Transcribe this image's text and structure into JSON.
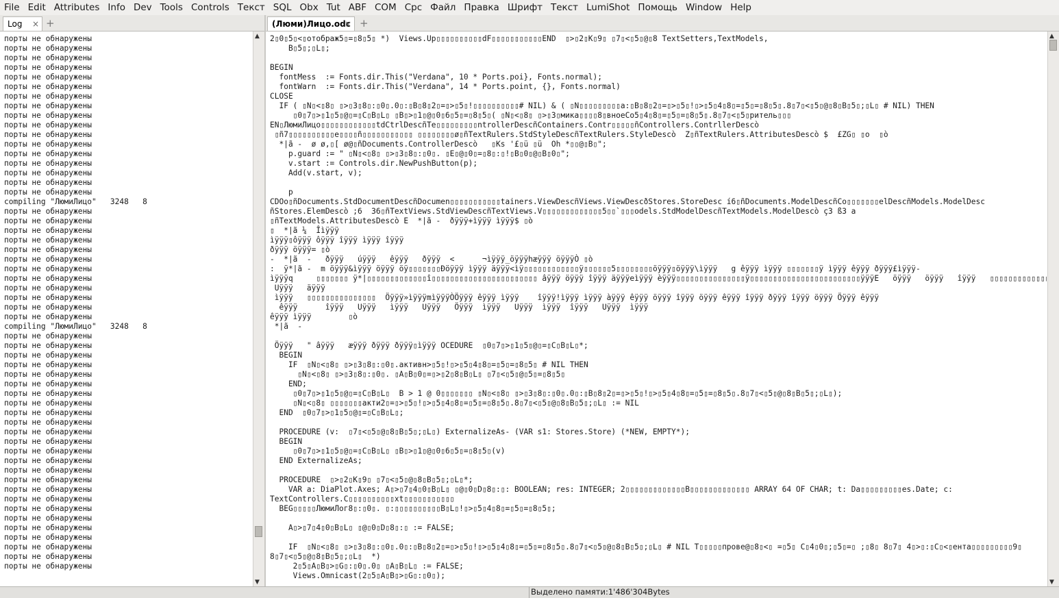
{
  "menubar": [
    "File",
    "Edit",
    "Attributes",
    "Info",
    "Dev",
    "Tools",
    "Controls",
    "Текст",
    "SQL",
    "Obx",
    "Tut",
    "ABF",
    "COM",
    "Срс",
    "Файл",
    "Правка",
    "Шрифт",
    "Текст",
    "LumiShot",
    "Помощь",
    "Window",
    "Help"
  ],
  "left_tab": {
    "label": "Log",
    "close": "×",
    "plus": "+"
  },
  "right_tab": {
    "label": "(Люми)Лицо.odc",
    "close": "×",
    "plus": "+"
  },
  "log": {
    "lines": [
      "порты не обнаружены",
      "порты не обнаружены",
      "порты не обнаружены",
      "порты не обнаружены",
      "порты не обнаружены",
      "порты не обнаружены",
      "порты не обнаружены",
      "порты не обнаружены",
      "порты не обнаружены",
      "порты не обнаружены",
      "порты не обнаружены",
      "порты не обнаружены",
      "порты не обнаружены",
      "порты не обнаружены",
      "порты не обнаружены",
      "порты не обнаружены",
      "порты не обнаружены",
      "compiling \"ЛюмиЛицо\"   3248   8",
      "порты не обнаружены",
      "порты не обнаружены",
      "порты не обнаружены",
      "порты не обнаружены",
      "порты не обнаружены",
      "порты не обнаружены",
      "порты не обнаружены",
      "порты не обнаружены",
      "порты не обнаружены",
      "порты не обнаружены",
      "порты не обнаружены",
      "порты не обнаружены",
      "compiling \"ЛюмиЛицо\"   3248   8",
      "порты не обнаружены",
      "порты не обнаружены",
      "порты не обнаружены",
      "порты не обнаружены",
      "порты не обнаружены",
      "порты не обнаружены",
      "порты не обнаружены",
      "порты не обнаружены",
      "порты не обнаружены",
      "порты не обнаружены",
      "порты не обнаружены",
      "порты не обнаружены",
      "порты не обнаружены",
      "порты не обнаружены",
      "порты не обнаружены",
      "порты не обнаружены",
      "порты не обнаружены",
      "порты не обнаружены",
      "порты не обнаружены",
      "порты не обнаружены",
      "порты не обнаружены",
      "порты не обнаружены",
      "порты не обнаружены",
      "порты не обнаружены",
      "порты не обнаружены"
    ]
  },
  "editor": {
    "lines": [
      "2▯0▯5▯<▯отображ5▯=▯8▯5▯ *)  Views.Up▯▯▯▯▯▯▯▯▯▯dF▯▯▯▯▯▯▯▯▯▯▯END  ▯>▯2▯K▯9▯ ▯7▯<▯5▯@▯8 TextSetters,TextModels,",
      "    B▯5▯;▯L▯;",
      "",
      "BEGIN",
      "  fontMess  := Fonts.dir.This(\"Verdana\", 10 * Ports.poi}, Fonts.normal);",
      "  fontWarn  := Fonts.dir.This(\"Verdana\", 14 * Ports.point, {}, Fonts.normal)",
      "CLOSE",
      "  IF ( ▯N▯<▯8▯ ▯>▯3▯8▯:▯0▯.0▯:▯B▯8▯2▯=▯>▯5▯!▯▯▯▯▯▯▯▯▯▯# NIL) & ( ▯N▯▯▯▯▯▯▯▯▯a:▯B▯8▯2▯=▯>▯5▯!▯>▯5▯4▯8▯=▯5▯=▯8▯5▯.8▯7▯<▯5▯@▯8▯B▯5▯;▯L▯ # NIL) THEN",
      "     ▯0▯7▯>▯1▯5▯@▯=▯C▯B▯L▯ ▯B▯>▯1▯@▯0▯6▯5▯=▯8▯5▯( ▯N▯<▯8▯ ▯>▯3▯мика▯▯▯▯8▯вноеСо5▯4▯8▯=▯5▯=▯8▯5▯.8▯7▯<▯5▯ритель▯▯▯",
      "EN▯ЛюмиЛицо▯▯▯▯▯▯▯▯▯▯▯▯tdCtrlDescñTe▯▯▯▯▯▯▯▯▯ntrollerDescñContainers.Contr▯▯▯▯▯ñControllers.ContrllerDescò",
      " ▯ñ7▯▯▯▯▯▯▯▯▯▯e▯▯▯▯ñ▯▯▯▯▯▯▯▯▯▯▯ ▯▯▯▯▯▯▯▯ø▯ñTextRulers.StdStyleDescñTextRulers.StyleDescò  Z▯ñTextRulers.AttributesDescò $  £ZG▯ ▯o  ▯ò",
      "  *|ã -  ø ø,▯[ ø@▯ñDocuments.ControllerDescò   ▯Ks '£▯ü ▯ü  Oh *▯▯@▯B▯\";",
      "    p.guard := \" ▯N▯<▯8▯ ▯>▯3▯8▯:▯0▯. ▯E▯@▯0▯=▯8▯:▯!▯B▯0▯@▯B▯0▯\";",
      "    v.start := Controls.dir.NewPushButton(p);",
      "    Add(v.start, v);",
      "",
      "    p",
      "CDOo▯ñDocuments.StdDocumentDescñDocumen▯▯▯▯▯▯▯▯▯▯▯tainers.ViewDescñViews.ViewDescðStores.StoreDesc í6▯ñDocuments.ModelDescñCo▯▯▯▯▯▯▯elDescñModels.ModelDesc",
      "ñStores.ElemDescò ;6  36▯ñTextViews.StdViewDescñTextViews.V▯▯▯▯▯▯▯▯▯▯▯▯▯5▯▯`▯▯▯odels.StdModelDescñTextModels.ModelDescò ç3 ß3 a",
      "▯ñTextModels.AttributesDescò E  *|ã -  ðÿÿÿ+ìÿÿÿ ìÿÿÿ$ ▯ò",
      "▯  *|ã ¼  Îìÿÿÿ",
      "ìÿÿÿ▯ôÿÿÿ ôÿÿÿ îÿÿÿ ìÿÿÿ îÿÿÿ",
      "ðÿÿÿ öÿÿÿ= ▯ò",
      "-  *|ã  -   ðÿÿÿ   úÿÿÿ   êÿÿÿ   ðÿÿÿ  <      ¬ìÿÿÿ_öÿÿÿhæÿÿÿ öÿÿÿÒ ▯ò",
      ":  ÿ*|ã -  m öÿÿÿ&ìÿÿÿ öÿÿÿ öÿ▯▯▯▯▯▯▯Ðöÿÿÿ ìÿÿÿ äÿÿÿ<ìÿ▯▯▯▯▯▯▯▯▯▯▯▯ÿ▯▯▯▯▯▯5▯▯▯▯▯▯▯▯öÿÿÿ▯öÿÿÿ\\ìÿÿÿ   g êÿÿÿ ìÿÿÿ ▯▯▯▯▯▯▯ÿ ìÿÿÿ êÿÿÿ ðÿÿÿ£ìÿÿÿ-",
      "ìÿÿÿq     ▯▯▯▯▯▯▯ ÿ*|▯▯▯▯▯▯▯▯▯▯▯▯▯î▯▯▯▯▯▯▯▯▯▯▯▯▯▯▯▯▯▯▯▯▯▯▯ âÿÿÿ öÿÿÿ îÿÿÿ äÿÿÿeìÿÿÿ èÿÿÿ▯▯▯▯▯▯▯▯▯▯▯▯▯▯▯ÿ▯▯▯▯▯▯▯▯▯▯▯▯▯▯▯▯▯▯▯▯▯▯▯▯ÿÿÿE   öÿÿÿ   öÿÿÿ   îÿÿÿ   ▯▯▯▯▯▯▯▯▯▯▯▯▯▯▯▯▯▯▯▯▯▯▯▯▯▯▯▯▯▯▯▯▯▯▯▯▯▯▯▯▯ÿ    ìÿÿÿ",
      " Uÿÿÿ   äÿÿÿ",
      " ìÿÿÿ   ▯▯▯▯▯▯▯▯▯▯▯▯▯▯▯  Öÿÿÿ»ìÿÿÿmìÿÿÿÒÖÿÿÿ êÿÿÿ ìÿÿÿ    îÿÿÿ!ìÿÿÿ ìÿÿÿ àÿÿÿ êÿÿÿ öÿÿÿ îÿÿÿ öÿÿÿ êÿÿÿ îÿÿÿ ðÿÿÿ îÿÿÿ öÿÿÿ Öÿÿÿ êÿÿÿ",
      "  êÿÿÿ      îÿÿÿ   Uÿÿÿ   ìÿÿÿ   Uÿÿÿ   Öÿÿÿ  ìÿÿÿ   Uÿÿÿ  ìÿÿÿ  îÿÿÿ   Uÿÿÿ  ìÿÿÿ",
      "êÿÿÿ ìÿÿÿ        ▯ò",
      " *|ã  -",
      "",
      " Öÿÿÿ   \" âÿÿÿ   æÿÿÿ ðÿÿÿ ðÿÿÿ▯ìÿÿÿ OCEDURE  ▯0▯7▯>▯1▯5▯@▯=▯C▯B▯L▯*;",
      "  BEGIN",
      "    IF  ▯N▯<▯8▯ ▯>▯3▯8▯:▯0▯.активн>▯5▯!▯>▯5▯4▯8▯=▯5▯=▯8▯5▯ # NIL THEN",
      "      ▯N▯<▯8▯ ▯>▯3▯8▯:▯0▯. ▯A▯B▯0▯=▯>▯2▯8▯B▯L▯ ▯7▯<▯5▯@▯5▯=▯8▯5▯",
      "    END;",
      "     ▯0▯7▯>▯1▯5▯@▯=▯C▯B▯L▯  B > 1 @ 0▯▯▯▯▯▯▯ ▯N▯<▯8▯ ▯>▯3▯8▯:▯0▯.0▯:▯B▯8▯2▯=▯>▯5▯!▯>▯5▯4▯8▯=▯5▯=▯8▯5▯.8▯7▯<▯5▯@▯8▯B▯5▯;▯L▯);",
      "     ▯N▯<▯8▯ ▯▯▯▯▯▯▯акти2▯=▯>▯5▯!▯>▯5▯4▯8▯=▯5▯=▯8▯5▯.8▯7▯<▯5▯@▯8▯B▯5▯;▯L▯ := NIL",
      "  END  ▯0▯7▯>▯1▯5▯@▯=▯C▯B▯L▯;",
      "",
      "  PROCEDURE (v:  ▯7▯<▯5▯@▯8▯B▯5▯;▯L▯) ExternalizeAs- (VAR s1: Stores.Store) (*NEW, EMPTY*);",
      "  BEGIN",
      "     ▯0▯7▯>▯1▯5▯@▯=▯C▯B▯L▯ ▯B▯>▯1▯@▯0▯6▯5▯=▯8▯5▯(v)",
      "  END ExternalizeAs;",
      "",
      "  PROCEDURE  ▯>▯2▯K▯9▯ ▯7▯<▯5▯@▯8▯B▯5▯;▯L▯*;",
      "    VAR a: DiaPlot.Axes; A▯>▯7▯4▯0▯B▯L▯ ▯@▯0▯D▯8▯:▯: BOOLEAN; res: INTEGER; 2▯▯▯▯▯▯▯▯▯▯▯▯▯B▯▯▯▯▯▯▯▯▯▯▯▯▯ ARRAY 64 OF CHAR; t: Da▯▯▯▯▯▯▯▯▯es.Date; c:",
      "TextControllers.C▯▯▯▯▯▯▯▯▯▯xt▯▯▯▯▯▯▯▯▯▯▯",
      "  BEG▯▯▯▯▯ЛюмиЛог8▯:▯0▯. ▯:▯▯▯▯▯▯▯▯▯▯B▯L▯!▯>▯5▯4▯8▯=▯5▯=▯8▯5▯;",
      "",
      "    A▯>▯7▯4▯0▯B▯L▯ ▯@▯0▯D▯8▯:▯ := FALSE;",
      "",
      "    IF  ▯N▯<▯8▯ ▯>▯3▯8▯:▯0▯.0▯:▯B▯8▯2▯=▯>▯5▯!▯>▯5▯4▯8▯=▯5▯=▯8▯5▯.8▯7▯<▯5▯@▯8▯B▯5▯;▯L▯ # NIL T▯▯▯▯▯прове@▯8▯<▯ =▯5▯ C▯4▯0▯;▯5▯=▯ ;▯8▯ 8▯7▯ 4▯>▯:▯C▯<▯ента▯▯▯▯▯▯▯▯▯9▯",
      "8▯7▯<▯5▯@▯8▯B▯5▯;▯L▯  *)",
      "     2▯5▯A▯B▯>▯G▯:▯0▯.0▯ ▯A▯B▯L▯ := FALSE;",
      "     Views.Omnicast(2▯5▯A▯B▯>▯G▯:▯0▯);"
    ]
  },
  "status": {
    "memory": "Выделено памяти:1'486'304Bytes"
  }
}
